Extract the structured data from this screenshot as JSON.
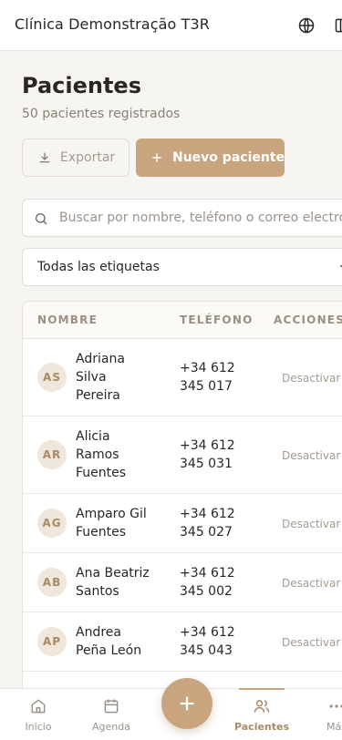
{
  "app": {
    "brand": "Clínica Demonstração T3R"
  },
  "header": {
    "title": "Pacientes",
    "subtitle": "50 pacientes registrados",
    "export_label": "Exportar",
    "new_label": "Nuevo paciente"
  },
  "search": {
    "placeholder": "Buscar por nombre, teléfono o correo electróni"
  },
  "filter": {
    "selected": "Todas las etiquetas"
  },
  "table": {
    "columns": [
      "NOMBRE",
      "TELÉFONO",
      "ACCIONES"
    ],
    "rows": [
      {
        "initials": "AS",
        "name": "Adriana Silva Pereira",
        "phone": "+34 612 345 017",
        "action": "Desactivar"
      },
      {
        "initials": "AR",
        "name": "Alicia Ramos Fuentes",
        "phone": "+34 612 345 031",
        "action": "Desactivar"
      },
      {
        "initials": "AG",
        "name": "Amparo Gil Fuentes",
        "phone": "+34 612 345 027",
        "action": "Desactivar"
      },
      {
        "initials": "AB",
        "name": "Ana Beatriz Santos",
        "phone": "+34 612 345 002",
        "action": "Desactivar"
      },
      {
        "initials": "AP",
        "name": "Andrea Peña León",
        "phone": "+34 612 345 043",
        "action": "Desactivar"
      }
    ]
  },
  "nav": {
    "items": [
      {
        "label": "Inicio",
        "icon": "home-icon"
      },
      {
        "label": "Agenda",
        "icon": "calendar-icon"
      },
      {
        "label": "Pacientes",
        "icon": "users-icon"
      },
      {
        "label": "Más",
        "icon": "more-icon"
      }
    ],
    "fab_icon": "plus-icon"
  },
  "colors": {
    "accent": "#c8a57f",
    "background": "#f7f5f1"
  }
}
